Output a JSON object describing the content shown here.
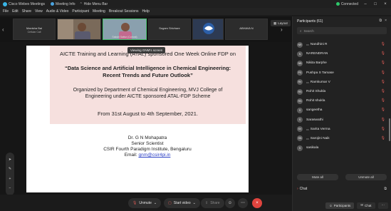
{
  "titlebar": {
    "app_title": "Cisco Webex Meetings",
    "meeting_info": "Meeting Info",
    "hide_menu_bar": "Hide Menu Bar",
    "connection": "Connected",
    "minimize": "–",
    "maximize": "□",
    "close": "×"
  },
  "menubar": {
    "items": [
      "File",
      "Edit",
      "Share",
      "View",
      "Audio & Video",
      "Participant",
      "Meeting",
      "Breakout Sessions",
      "Help"
    ]
  },
  "strip": {
    "tiles": [
      {
        "name": "Manisha Bai",
        "sub": "Cellular Call"
      },
      {
        "name": "",
        "sub": ""
      },
      {
        "name": "",
        "sub": "",
        "label": "Sakshi Sattur (Cohost)"
      },
      {
        "name": "Sugam Shivhare",
        "sub": ""
      },
      {
        "name": "",
        "sub": ""
      },
      {
        "name": "ABHAVA N",
        "sub": ""
      }
    ],
    "layout_label": "Layout"
  },
  "share": {
    "banner": "Viewing GNM's screen",
    "slide": {
      "title": "AICTE Training and Learning (ATAL) sponsored One Week Online FDP on",
      "subtitle": "“Data Science and Artificial Intelligence in Chemical Engineering: Recent Trends and Future Outlook”",
      "organizer": "Organized by Department of Chemical Engineering, MVJ College of Engineering under AICTE sponsored ATAL-FDP Scheme",
      "dates": "From 31st August to 4th September, 2021.",
      "speaker_name": "Dr. G N Mohapatra",
      "speaker_role": "Senior Scientist",
      "speaker_org": "CSIR Fourth Paradigm Institute, Bengaluru",
      "email_label": "Email:",
      "email": "gnm@csir4pi.in"
    }
  },
  "controls": {
    "unmute": "Unmute",
    "start_video": "Start video",
    "share": "Share"
  },
  "panel": {
    "header": "Participants (61)",
    "search_placeholder": "Search",
    "participants": [
      {
        "initials": "NR",
        "name": "Nandhini R",
        "muted": true
      },
      {
        "initials": "N",
        "name": "NARENDRAN",
        "muted": true
      },
      {
        "initials": "NB",
        "name": "Nikita Barphe",
        "muted": true
      },
      {
        "initials": "PS",
        "name": "Pushpa S Tamase",
        "muted": true
      },
      {
        "initials": "RV",
        "name": "Ramkumar V",
        "muted": true
      },
      {
        "initials": "RS",
        "name": "Rohit Shukla",
        "muted": true
      },
      {
        "initials": "RS",
        "name": "Rohit shukla",
        "muted": true
      },
      {
        "initials": "S",
        "name": "sangeetha",
        "muted": true
      },
      {
        "initials": "S",
        "name": "Saraswathi",
        "muted": true
      },
      {
        "initials": "SV",
        "name": "Sarita Verma",
        "muted": true
      },
      {
        "initials": "SN",
        "name": "Sarojini Naik",
        "muted": true
      },
      {
        "initials": "S",
        "name": "sasikala",
        "muted": false
      }
    ],
    "mute_all": "Mute all",
    "unmute_all": "Unmute all",
    "chat": "Chat",
    "footer_participants": "Participants",
    "footer_chat": "Chat"
  }
}
